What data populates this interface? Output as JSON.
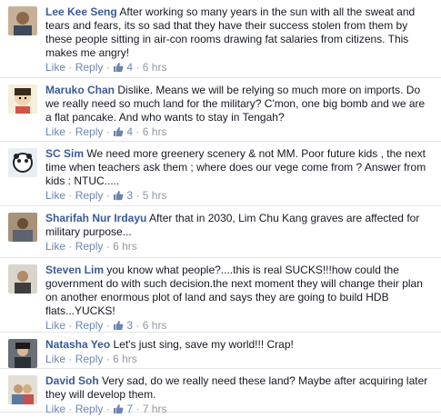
{
  "actions": {
    "like": "Like",
    "reply": "Reply",
    "dot": "·"
  },
  "comments": [
    {
      "author": "Lee Kee Seng",
      "text": "After working so many years in the sun with all the sweat and tears and fears, its so sad that they have their success stolen from them by these people sitting in air-con rooms drawing fat salaries from citizens. This makes me angry!",
      "likes": "4",
      "time": "6 hrs"
    },
    {
      "author": "Maruko Chan",
      "text": "Dislike. Means we will be relying so much more on imports. Do we really need so much land for the military? C'mon, one big bomb and we are a flat pancake. And who wants to stay in Tengah?",
      "likes": "4",
      "time": "6 hrs"
    },
    {
      "author": "SC Sim",
      "text": "We need more greenery scenery & not MM. Poor future kids , the next time when teachers ask them ; where does our vege come from ? Answer from kids : NTUC.....",
      "likes": "3",
      "time": "5 hrs"
    },
    {
      "author": "Sharifah Nur Irdayu",
      "text": "After that in 2030, Lim Chu Kang graves are affected for military purpose...",
      "likes": "",
      "time": "6 hrs"
    },
    {
      "author": "Steven Lim",
      "text": "you know what people?....this is real SUCKS!!!how could the government do with such decision.the next moment they will change their plan on another enormous plot of land and says they are going to build HDB flats...YUCKS!",
      "likes": "3",
      "time": "6 hrs"
    },
    {
      "author": "Natasha Yeo",
      "text": "Let's just sing, save my world!!! Crap!",
      "likes": "",
      "time": "6 hrs"
    },
    {
      "author": "David Soh",
      "text": "Very sad, do we really need these land? Maybe after acquiring later they will develop them.",
      "likes": "7",
      "time": "7 hrs"
    }
  ],
  "colors": {
    "link": "#3b5998",
    "action": "#6d84b4",
    "meta": "#9197a3",
    "text": "#141823"
  },
  "icons": [
    "thumbs-up-icon"
  ]
}
